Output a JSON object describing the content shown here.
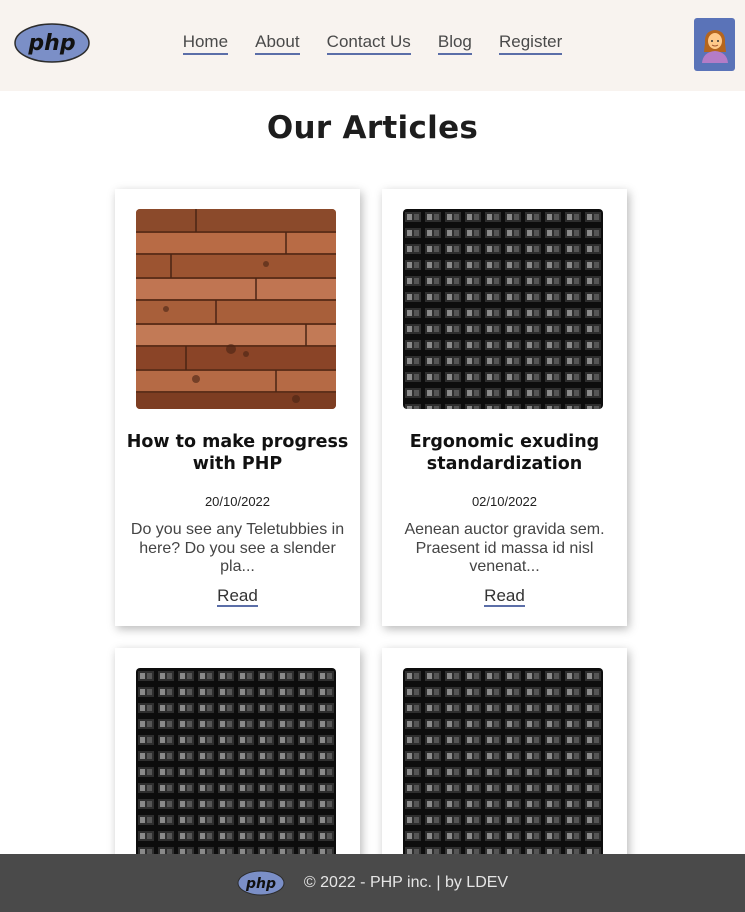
{
  "header": {
    "logo_text": "php",
    "nav": [
      {
        "label": "Home"
      },
      {
        "label": "About"
      },
      {
        "label": "Contact Us"
      },
      {
        "label": "Blog"
      },
      {
        "label": "Register"
      }
    ],
    "avatar_icon": "woman-avatar-icon"
  },
  "main": {
    "title": "Our Articles",
    "articles": [
      {
        "title": "How to make progress with PHP",
        "date": "20/10/2022",
        "excerpt": "Do you see any Teletubbies in here? Do you see a slender pla...",
        "read_label": "Read",
        "image": "wood-planks"
      },
      {
        "title": "Ergonomic exuding standardization",
        "date": "02/10/2022",
        "excerpt": "Aenean auctor gravida sem. Praesent id massa id nisl venenat...",
        "read_label": "Read",
        "image": "building-windows"
      },
      {
        "image": "building-windows"
      },
      {
        "image": "building-windows"
      }
    ]
  },
  "footer": {
    "logo_text": "php",
    "copyright": "© 2022 - PHP inc. | by LDEV"
  },
  "colors": {
    "header_bg": "#f8f3ef",
    "accent": "#5b6ea8",
    "footer_bg": "#4a4a4a",
    "avatar_bg": "#5a73b8"
  }
}
